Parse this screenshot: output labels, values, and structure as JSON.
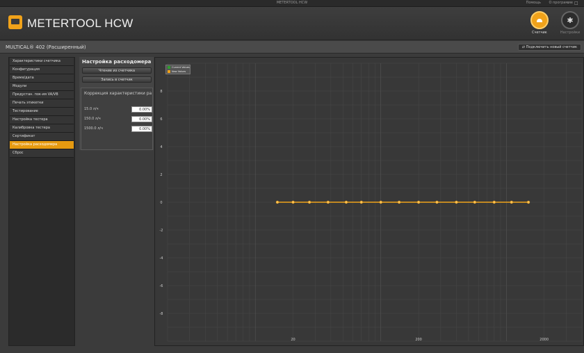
{
  "window": {
    "title": "METERTOOL HCW",
    "links": [
      "Помощь",
      "О программе"
    ],
    "controls": [
      "–",
      "□"
    ]
  },
  "header": {
    "app_title": "METERTOOL HCW",
    "nav": [
      {
        "label": "Счетчик",
        "icon": "meter-icon",
        "active": true
      },
      {
        "label": "Настройки",
        "icon": "gear-icon",
        "active": false
      }
    ]
  },
  "subbar": {
    "device": "MULTICAL® 402 (Расширенный)",
    "connect_label": "Подключить новый счетчик"
  },
  "sidebar": {
    "items": [
      {
        "label": "Характеристики счетчика"
      },
      {
        "label": "Конфигурация"
      },
      {
        "label": "Время/дата"
      },
      {
        "label": "Модули"
      },
      {
        "label": "Предустан. пок-ия VA/VB"
      },
      {
        "label": "Печать этикетки"
      },
      {
        "label": "Тестирование"
      },
      {
        "label": "Настройка тестера"
      },
      {
        "label": "Калибровка тестера"
      },
      {
        "label": "Сертификат"
      },
      {
        "label": "Настройка расходомера",
        "active": true
      },
      {
        "label": "Сброс"
      }
    ]
  },
  "panel": {
    "title": "Настройка расходомера",
    "read_button": "Чтение из счетчика",
    "write_button": "Запись в счетчик",
    "correction_title": "Коррекция характеристики ра",
    "rows": [
      {
        "label": "15.0 л/ч",
        "value": "0.00%"
      },
      {
        "label": "150.0 л/ч",
        "value": "0.00%"
      },
      {
        "label": "1500.0 л/ч",
        "value": "0.00%"
      }
    ]
  },
  "colors": {
    "accent": "#f0a21a",
    "series_current": "#2e9e2e",
    "series_new": "#f0a21a"
  },
  "chart_data": {
    "type": "line",
    "x_scale": "log",
    "xlim": [
      2,
      4000
    ],
    "ylim": [
      -10,
      10
    ],
    "x_ticks": [
      20,
      200,
      2000
    ],
    "x_tick_labels": [
      "20",
      "200",
      "2000"
    ],
    "y_ticks": [
      8,
      6,
      4,
      2,
      0,
      -2,
      -4,
      -6,
      -8
    ],
    "y_tick_labels": [
      "8",
      "6",
      "4",
      "2",
      "0",
      "-2",
      "-4",
      "-6",
      "-8"
    ],
    "grid": true,
    "legend": "top-left",
    "series": [
      {
        "name": "Current Values",
        "x": [],
        "y": []
      },
      {
        "name": "New Values",
        "x": [
          15,
          20,
          27,
          38,
          53,
          70,
          100,
          140,
          200,
          280,
          400,
          560,
          800,
          1100,
          1500
        ],
        "y": [
          0,
          0,
          0,
          0,
          0,
          0,
          0,
          0,
          0,
          0,
          0,
          0,
          0,
          0,
          0
        ]
      }
    ]
  }
}
